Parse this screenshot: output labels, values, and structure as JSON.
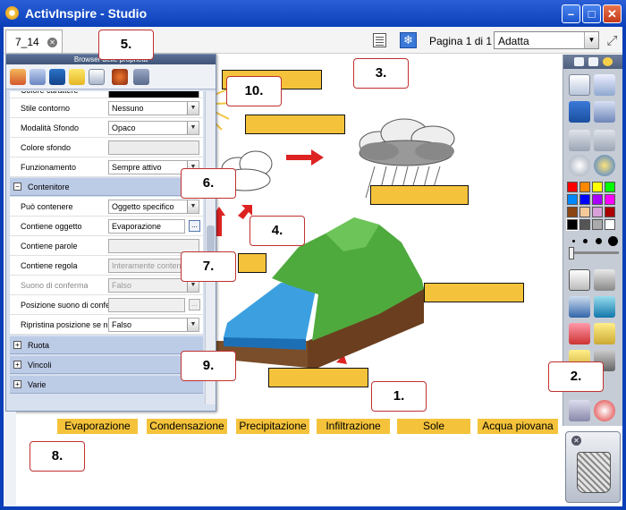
{
  "window": {
    "title": "ActivInspire - Studio",
    "min": "–",
    "max": "□",
    "close": "✕"
  },
  "toolbar": {
    "tab_label": "7_14",
    "tab_close": "✕",
    "snow_glyph": "❄",
    "page_label": "Pagina 1 di 1",
    "zoom_value": "Adatta",
    "zoom_arrow": "▼",
    "fullscreen_glyph": "⤢"
  },
  "panel": {
    "title": "Browser delle proprietà",
    "rows": [
      {
        "key": "Colore carattere",
        "value": ""
      },
      {
        "key": "Stile contorno",
        "value": "Nessuno"
      },
      {
        "key": "Modalità Sfondo",
        "value": "Opaco"
      },
      {
        "key": "Colore sfondo",
        "value": ""
      },
      {
        "key": "Funzionamento",
        "value": "Sempre attivo"
      }
    ],
    "section_container": "Contenitore",
    "container_rows": [
      {
        "key": "Può contenere",
        "value": "Oggetto specifico"
      },
      {
        "key": "Contiene oggetto",
        "value": "Evaporazione"
      },
      {
        "key": "Contiene parole",
        "value": ""
      },
      {
        "key": "Contiene regola",
        "value": "Interamente contenuto"
      },
      {
        "key": "Suono di conferma",
        "value": "Falso"
      },
      {
        "key": "Posizione suono di conferma",
        "value": ""
      },
      {
        "key": "Ripristina posizione se non",
        "value": "Falso"
      }
    ],
    "sections_collapsed": [
      "Ruota",
      "Vincoli",
      "Varie"
    ],
    "browse_glyph": "...",
    "plus": "+",
    "minus": "−",
    "dd_arrow": "▼"
  },
  "callouts": [
    "1.",
    "2.",
    "3.",
    "4.",
    "5.",
    "6.",
    "7.",
    "8.",
    "9.",
    "10."
  ],
  "words": [
    "Evaporazione",
    "Condensazione",
    "Precipitazione",
    "Infiltrazione",
    "Sole",
    "Acqua piovana"
  ],
  "colors": {
    "answer_box": "#f5c33b",
    "title_bar": "#0a3fb8",
    "callout_border": "#c03030"
  }
}
